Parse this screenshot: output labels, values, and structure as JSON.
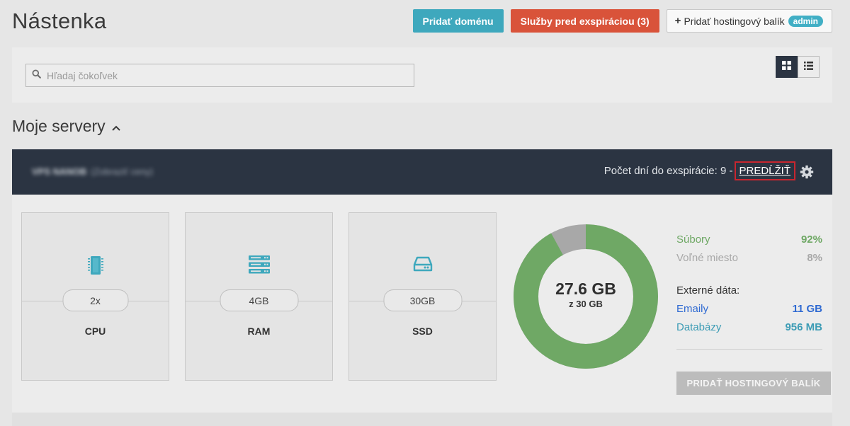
{
  "header": {
    "title": "Nástenka",
    "buttons": {
      "add_domain": "Pridať doménu",
      "expiring": "Služby pred exspiráciou (3)",
      "add_hosting": "Pridať hostingový balík",
      "admin_badge": "admin"
    }
  },
  "search": {
    "placeholder": "Hľadaj čokoľvek"
  },
  "section": {
    "title": "Moje servery"
  },
  "server": {
    "name": "VPS NANOB",
    "name_sub": "(Zobraziť ceny)",
    "expiry_text": "Počet dní do exspirácie: 9 -",
    "renew_label": "PREDĹŽIŤ",
    "specs": [
      {
        "value": "2x",
        "label": "CPU",
        "icon": "cpu-chip-icon"
      },
      {
        "value": "4GB",
        "label": "RAM",
        "icon": "server-stack-icon"
      },
      {
        "value": "30GB",
        "label": "SSD",
        "icon": "hard-drive-icon"
      }
    ],
    "storage": {
      "used": "27.6 GB",
      "total": "z 30 GB",
      "files_pct": 92,
      "free_pct": 8
    },
    "stats": {
      "files_label": "Súbory",
      "files_value": "92%",
      "free_label": "Voľné miesto",
      "free_value": "8%",
      "external_title": "Externé dáta:",
      "emails_label": "Emaily",
      "emails_value": "11 GB",
      "db_label": "Databázy",
      "db_value": "956 MB"
    },
    "add_button": "PRIDAŤ HOSTINGOVÝ BALÍK"
  },
  "colors": {
    "accent_teal": "#3ea8bd",
    "accent_orange": "#d9533a",
    "dark_header": "#2b3442",
    "files_green": "#6fa865",
    "free_grey": "#a8a8a8",
    "renew_highlight": "#c8262f"
  }
}
